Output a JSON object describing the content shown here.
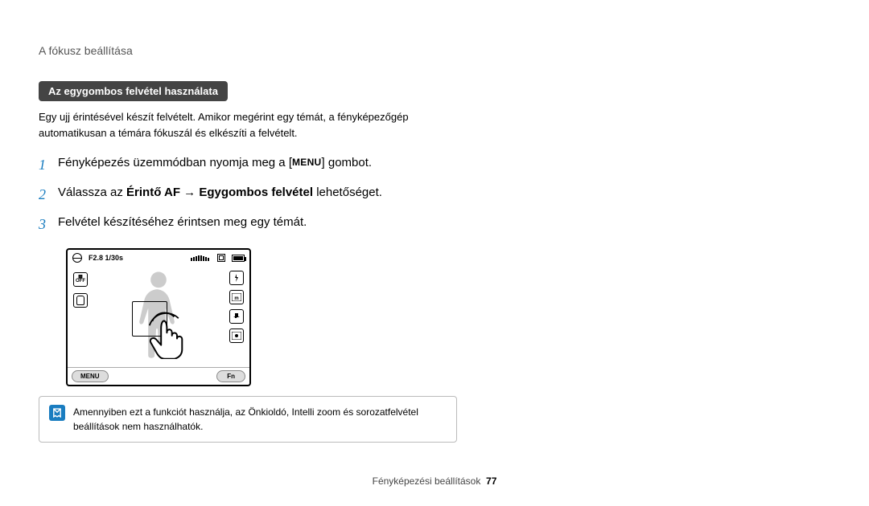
{
  "header": {
    "title": "A fókusz beállítása"
  },
  "section_title": "Az egygombos felvétel használata",
  "intro": "Egy ujj érintésével készít felvételt. Amikor megérint egy témát, a fényképezőgép automatikusan a témára fókuszál és elkészíti a felvételt.",
  "steps": [
    {
      "num": "1",
      "pre": "Fényképezés üzemmódban nyomja meg a [",
      "btn": "MENU",
      "post": "] gombot."
    },
    {
      "num": "2",
      "pre": "Válassza az ",
      "b1": "Érintő AF",
      "arrow": " → ",
      "b2": "Egygombos felvétel",
      "post": " lehetőséget."
    },
    {
      "num": "3",
      "text": "Felvétel készítéséhez érintsen meg egy témát."
    }
  ],
  "camera": {
    "exposure": "F2.8 1/30s",
    "menu_btn": "MENU",
    "fn_btn": "Fn",
    "off_label": "OFF"
  },
  "note": "Amennyiben ezt a funkciót használja, az Önkioldó, Intelli zoom és sorozatfelvétel beállítások nem használhatók.",
  "footer": {
    "section": "Fényképezési beállítások",
    "page": "77"
  }
}
